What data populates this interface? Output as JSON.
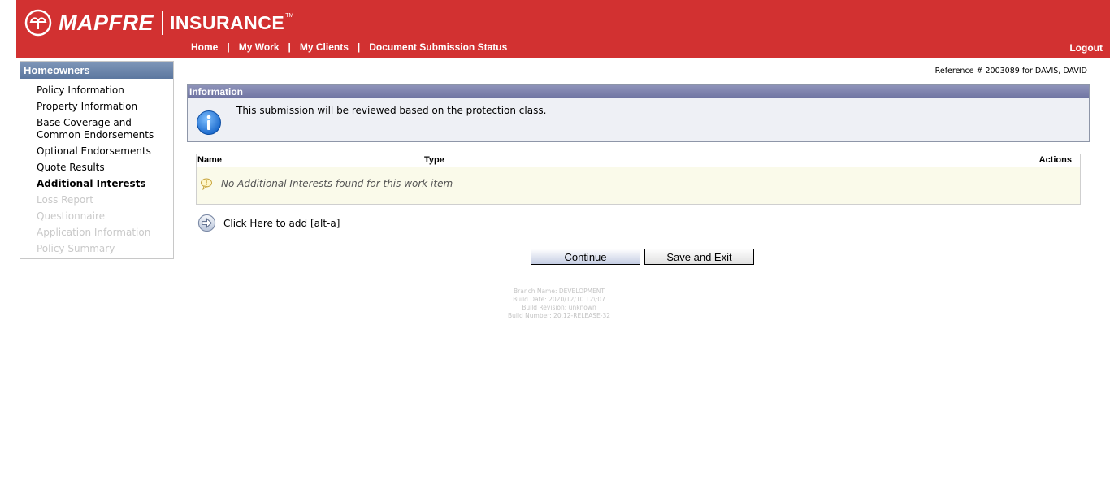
{
  "header": {
    "brand": "MAPFRE",
    "product": "INSURANCE",
    "trademark": "TM",
    "nav": [
      {
        "label": "Home"
      },
      {
        "label": "My Work"
      },
      {
        "label": "My Clients"
      },
      {
        "label": "Document Submission Status"
      }
    ],
    "nav_separator": "|",
    "logout": "Logout",
    "colors": {
      "header_bg": "#d23131"
    }
  },
  "sidebar": {
    "title": "Homeowners",
    "items": [
      {
        "label": "Policy Information",
        "state": "enabled"
      },
      {
        "label": "Property Information",
        "state": "enabled"
      },
      {
        "label": "Base Coverage and Common Endorsements",
        "state": "enabled"
      },
      {
        "label": "Optional Endorsements",
        "state": "enabled"
      },
      {
        "label": "Quote Results",
        "state": "enabled"
      },
      {
        "label": "Additional Interests",
        "state": "active"
      },
      {
        "label": "Loss Report",
        "state": "disabled"
      },
      {
        "label": "Questionnaire",
        "state": "disabled"
      },
      {
        "label": "Application Information",
        "state": "disabled"
      },
      {
        "label": "Policy Summary",
        "state": "disabled"
      }
    ]
  },
  "reference": "Reference # 2003089 for DAVIS, DAVID",
  "info": {
    "title": "Information",
    "message": "This submission will be reviewed based on the protection class.",
    "icon": "info-icon"
  },
  "additional_interests": {
    "columns": {
      "name": "Name",
      "type": "Type",
      "actions": "Actions"
    },
    "empty_message": "No Additional Interests found for this work item",
    "empty_icon": "speech-bubble-icon"
  },
  "add_link": {
    "label": "Click Here to add [alt-a]",
    "icon": "arrow-right-circle-icon"
  },
  "buttons": {
    "continue": "Continue",
    "save_exit": "Save and Exit"
  },
  "build": {
    "lines": [
      "Branch Name: DEVELOPMENT",
      "Build Date: 2020/12/10 12\\:07",
      "Build Revision: unknown",
      "Build Number: 20.12-RELEASE-32"
    ]
  }
}
